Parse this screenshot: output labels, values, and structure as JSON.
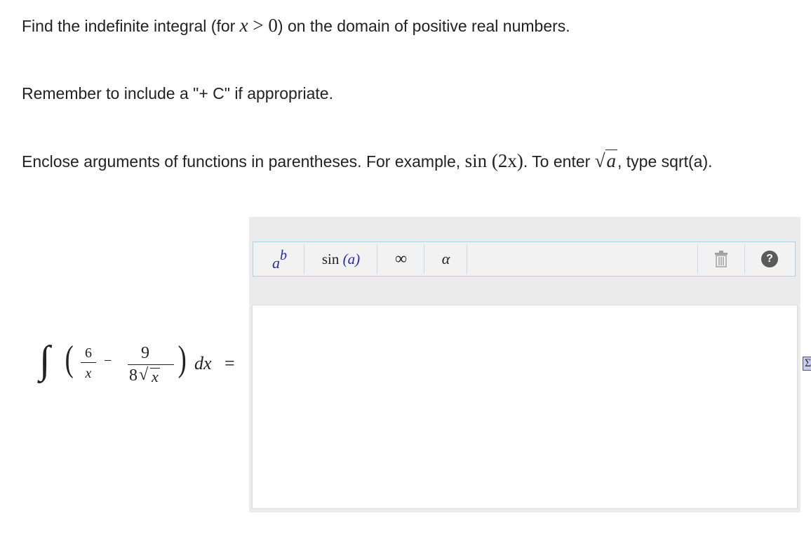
{
  "instructions": {
    "line1_pre": "Find the indefinite integral (for ",
    "line1_var": "x",
    "line1_op": " > 0",
    "line1_post": ") on the domain of positive real numbers.",
    "line2": "Remember to include a \"+ C\" if appropriate.",
    "line3_pre": "Enclose arguments of functions in parentheses. For example, ",
    "line3_fn": "sin",
    "line3_arg": "(2x)",
    "line3_mid": ". To enter ",
    "line3_sqrt_arg": "a",
    "line3_post": ", type sqrt(a)."
  },
  "problem": {
    "integral_sign": "∫",
    "term1_num": "6",
    "term1_den": "x",
    "minus": "−",
    "term2_num": "9",
    "term2_den_coef": "8",
    "term2_den_var": "x",
    "differential": "dx",
    "equals": "="
  },
  "toolbar": {
    "power_base": "a",
    "power_exp": "b",
    "sin_fn": "sin",
    "sin_arg": "(a)",
    "infinity": "∞",
    "alpha": "α",
    "help": "?"
  },
  "answer": {
    "value": ""
  },
  "sigma_label": "Σ",
  "colors": {
    "accent_blue": "#2a2aa8",
    "toolbar_border": "#a9d5ec",
    "help_bg": "#5a5a5a"
  }
}
